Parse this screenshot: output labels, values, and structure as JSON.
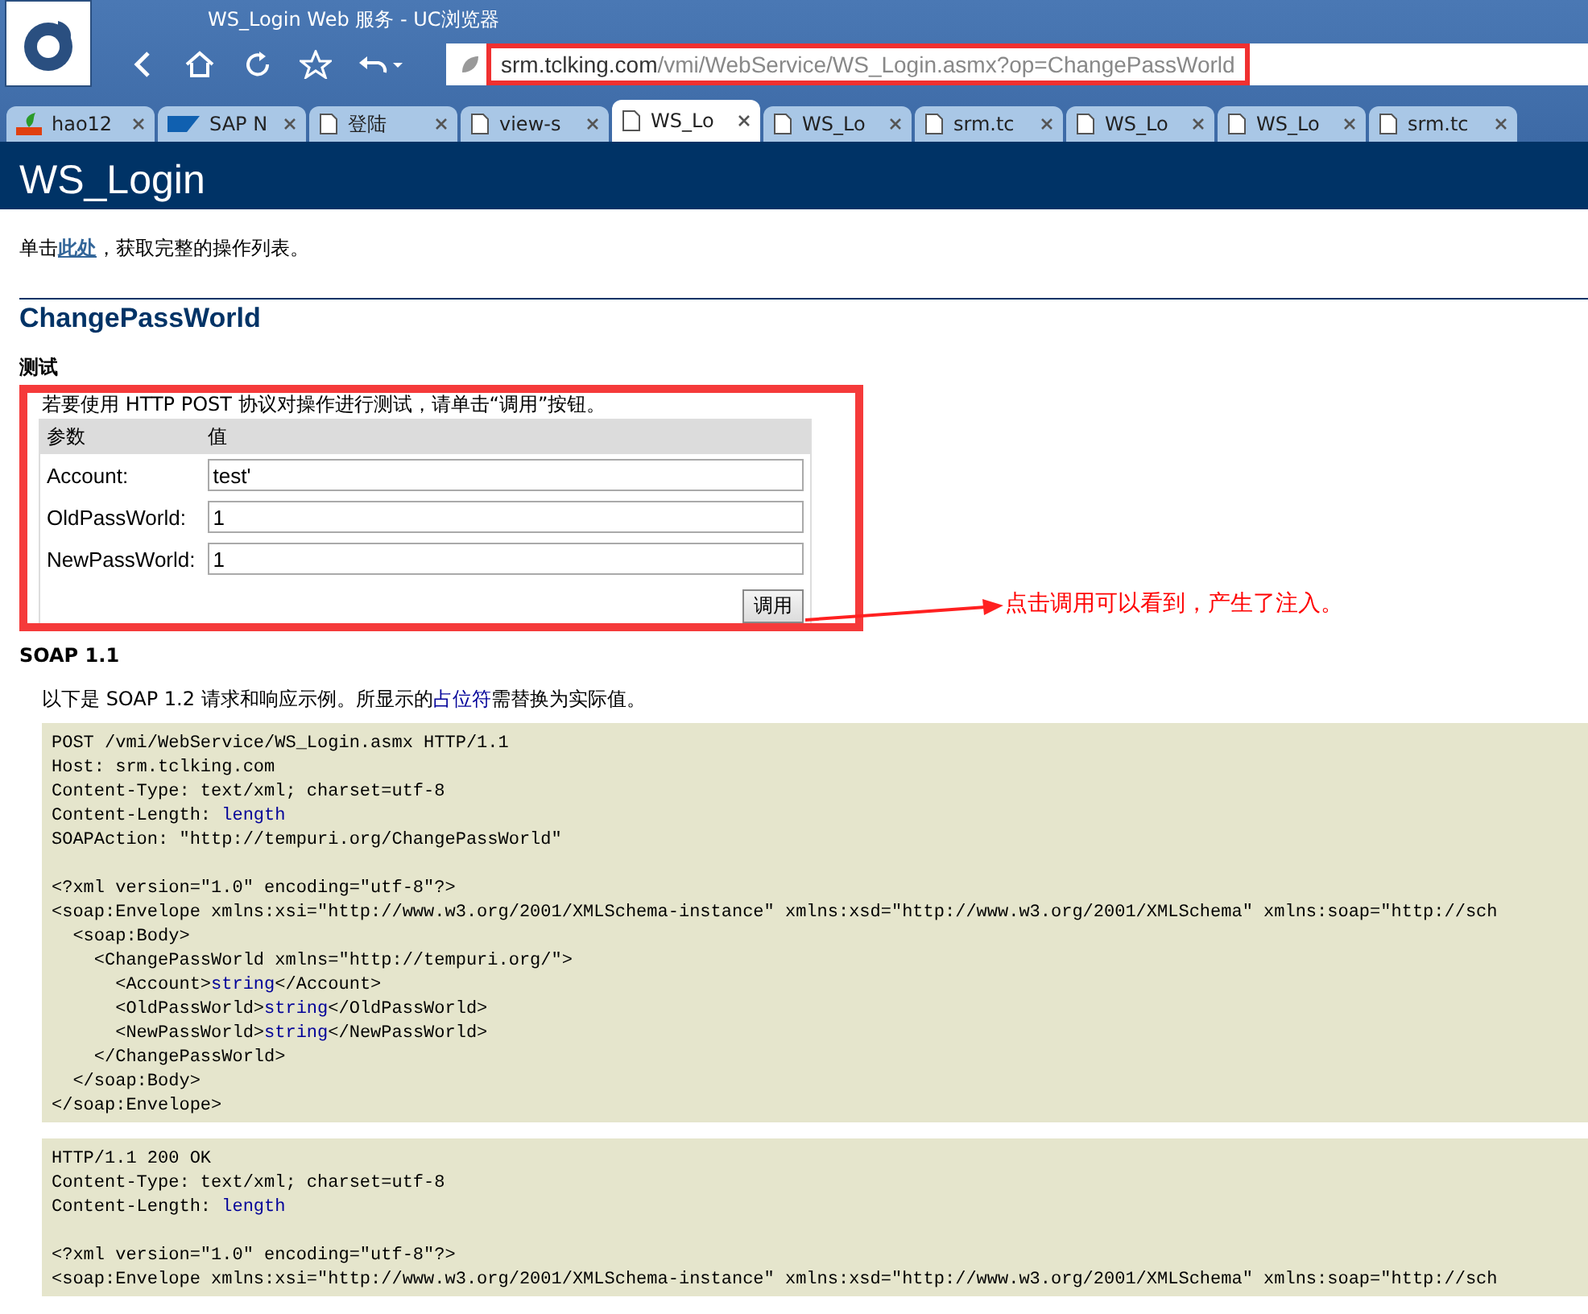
{
  "window": {
    "title": "WS_Login Web 服务 - UC浏览器"
  },
  "address_bar": {
    "host": "srm.tclking.com",
    "path": "/vmi/WebService/WS_Login.asmx?op=ChangePassWorld",
    "highlighted": true
  },
  "tabs": [
    {
      "label": "hao12",
      "kind": "hao",
      "selected": false
    },
    {
      "label": "SAP N",
      "kind": "sap",
      "selected": false
    },
    {
      "label": "登陆",
      "kind": "page",
      "selected": false
    },
    {
      "label": "view-s",
      "kind": "page",
      "selected": false
    },
    {
      "label": "WS_Lo",
      "kind": "page",
      "selected": true
    },
    {
      "label": "WS_Lo",
      "kind": "page",
      "selected": false
    },
    {
      "label": "srm.tc",
      "kind": "page",
      "selected": false
    },
    {
      "label": "WS_Lo",
      "kind": "page",
      "selected": false
    },
    {
      "label": "WS_Lo",
      "kind": "page",
      "selected": false
    },
    {
      "label": "srm.tc",
      "kind": "page",
      "selected": false
    }
  ],
  "page": {
    "header": "WS_Login",
    "intro": {
      "before": "单击",
      "link": "此处",
      "after": "，获取完整的操作列表。"
    },
    "operation": "ChangePassWorld",
    "test_heading": "测试",
    "test_form": {
      "highlighted": true,
      "note": "若要使用 HTTP POST 协议对操作进行测试，请单击“调用”按钮。",
      "columns": [
        "参数",
        "值"
      ],
      "params": [
        {
          "label": "Account:",
          "value": "test'"
        },
        {
          "label": "OldPassWorld:",
          "value": "1"
        },
        {
          "label": "NewPassWorld:",
          "value": "1"
        }
      ],
      "button": "调用"
    },
    "annotation": {
      "text": "点击调用可以看到，产生了注入。"
    },
    "soap_heading": "SOAP 1.1",
    "soap_intro": {
      "before": "以下是 SOAP 1.2 请求和响应示例。所显示的",
      "link": "占位符",
      "after": "需替换为实际值。"
    },
    "code_blocks": [
      {
        "sections": [
          [
            [
              {
                "kind": "plain",
                "text": "POST /vmi/WebService/WS_Login.asmx HTTP/1.1"
              }
            ],
            [
              {
                "kind": "plain",
                "text": "Host: srm.tclking.com"
              }
            ],
            [
              {
                "kind": "plain",
                "text": "Content-Type: text/xml; charset=utf-8"
              }
            ],
            [
              {
                "kind": "plain",
                "text": "Content-Length: "
              },
              {
                "kind": "placeholder",
                "text": "length"
              }
            ],
            [
              {
                "kind": "plain",
                "text": "SOAPAction: \"http://tempuri.org/ChangePassWorld\""
              }
            ]
          ],
          [
            [
              {
                "kind": "plain",
                "text": "<?xml version=\"1.0\" encoding=\"utf-8\"?>"
              }
            ],
            [
              {
                "kind": "plain",
                "text": "<soap:Envelope xmlns:xsi=\"http://www.w3.org/2001/XMLSchema-instance\" xmlns:xsd=\"http://www.w3.org/2001/XMLSchema\" xmlns:soap=\"http://sch"
              }
            ],
            [
              {
                "kind": "plain",
                "text": "  <soap:Body>"
              }
            ],
            [
              {
                "kind": "plain",
                "text": "    <ChangePassWorld xmlns=\"http://tempuri.org/\">"
              }
            ],
            [
              {
                "kind": "plain",
                "text": "      <Account>"
              },
              {
                "kind": "placeholder",
                "text": "string"
              },
              {
                "kind": "plain",
                "text": "</Account>"
              }
            ],
            [
              {
                "kind": "plain",
                "text": "      <OldPassWorld>"
              },
              {
                "kind": "placeholder",
                "text": "string"
              },
              {
                "kind": "plain",
                "text": "</OldPassWorld>"
              }
            ],
            [
              {
                "kind": "plain",
                "text": "      <NewPassWorld>"
              },
              {
                "kind": "placeholder",
                "text": "string"
              },
              {
                "kind": "plain",
                "text": "</NewPassWorld>"
              }
            ],
            [
              {
                "kind": "plain",
                "text": "    </ChangePassWorld>"
              }
            ],
            [
              {
                "kind": "plain",
                "text": "  </soap:Body>"
              }
            ],
            [
              {
                "kind": "plain",
                "text": "</soap:Envelope>"
              }
            ]
          ]
        ]
      },
      {
        "sections": [
          [
            [
              {
                "kind": "plain",
                "text": "HTTP/1.1 200 OK"
              }
            ],
            [
              {
                "kind": "plain",
                "text": "Content-Type: text/xml; charset=utf-8"
              }
            ],
            [
              {
                "kind": "plain",
                "text": "Content-Length: "
              },
              {
                "kind": "placeholder",
                "text": "length"
              }
            ]
          ],
          [
            [
              {
                "kind": "plain",
                "text": "<?xml version=\"1.0\" encoding=\"utf-8\"?>"
              }
            ],
            [
              {
                "kind": "plain",
                "text": "<soap:Envelope xmlns:xsi=\"http://www.w3.org/2001/XMLSchema-instance\" xmlns:xsd=\"http://www.w3.org/2001/XMLSchema\" xmlns:soap=\"http://sch"
              }
            ]
          ]
        ]
      }
    ]
  }
}
